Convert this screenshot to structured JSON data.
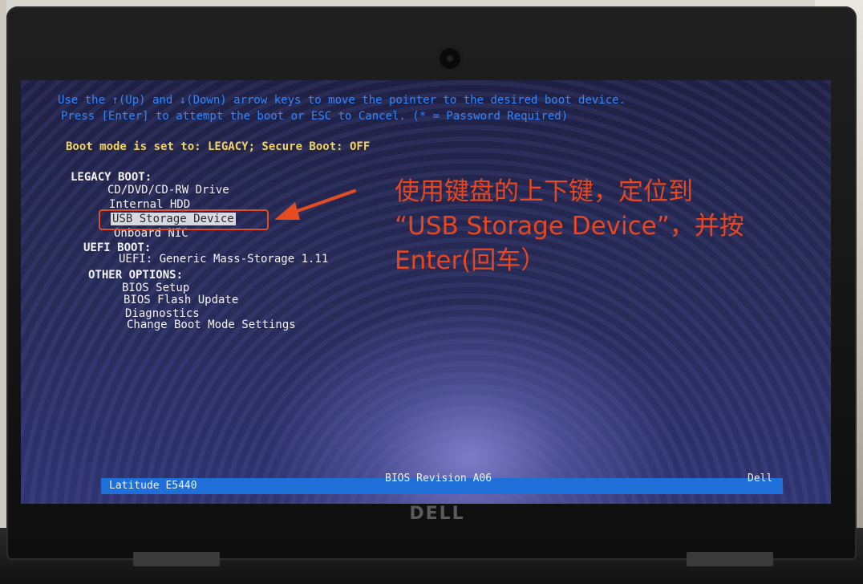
{
  "bios": {
    "instruction_line1": "Use the ↑(Up) and ↓(Down) arrow keys to move the pointer to the desired boot device.",
    "instruction_line2": "Press [Enter] to attempt the boot or ESC to Cancel. (* = Password Required)",
    "boot_mode": "Boot mode is set to: LEGACY; Secure Boot: OFF",
    "legacy_boot_header": "LEGACY BOOT:",
    "legacy_items": [
      "CD/DVD/CD-RW Drive",
      "Internal HDD",
      "USB Storage Device",
      "Onboard NIC"
    ],
    "selected_item": "USB Storage Device",
    "uefi_boot_header": "UEFI BOOT:",
    "uefi_items": [
      "UEFI: Generic Mass-Storage 1.11"
    ],
    "other_options_header": "OTHER OPTIONS:",
    "other_items": [
      "BIOS Setup",
      "BIOS Flash Update",
      "Diagnostics",
      "Change Boot Mode Settings"
    ]
  },
  "status_bar": {
    "model": "Latitude E5440",
    "revision": "BIOS Revision A06",
    "brand": "Dell"
  },
  "annotation": {
    "text": "使用键盘的上下键，定位到\n“USB Storage Device”，并按\nEnter(回车）",
    "color": "#e8461e"
  },
  "bezel_logo": "DELL",
  "side_volume": {
    "plus": "+",
    "minus": "-"
  }
}
